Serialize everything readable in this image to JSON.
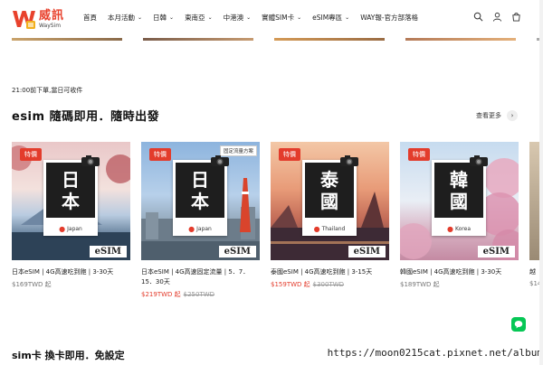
{
  "brand": {
    "name": "威訊",
    "sub": "WaySim",
    "color": "#e8412c"
  },
  "nav": [
    {
      "label": "首頁",
      "dropdown": false
    },
    {
      "label": "本月活動",
      "dropdown": true
    },
    {
      "label": "日韓",
      "dropdown": true
    },
    {
      "label": "東南亞",
      "dropdown": true
    },
    {
      "label": "中港澳",
      "dropdown": true
    },
    {
      "label": "實體SIM卡",
      "dropdown": true
    },
    {
      "label": "eSIM專區",
      "dropdown": true
    },
    {
      "label": "WAY報-官方部落格",
      "dropdown": false
    }
  ],
  "header_icons": [
    "search-icon",
    "user-icon",
    "cart-icon"
  ],
  "notice": "21:00前下單,當日可收件",
  "section": {
    "title": "esim 隨碼即用．隨時出發",
    "view_more": "查看更多"
  },
  "products": [
    {
      "tag": "特價",
      "frame_text": [
        "日",
        "本"
      ],
      "location": "Japan",
      "badge": "eSIM",
      "plan_label": "",
      "title": "日本eSIM | 4G高速吃到飽 | 3-30天",
      "price": "$169TWD 起",
      "sale": "",
      "original": ""
    },
    {
      "tag": "特價",
      "frame_text": [
        "日",
        "本"
      ],
      "location": "Japan",
      "badge": "eSIM",
      "plan_label": "固定流量方案",
      "title": "日本eSIM | 4G高速固定流量 | 5．7．15．30天",
      "price": "",
      "sale": "$219TWD 起",
      "original": "$250TWD"
    },
    {
      "tag": "特價",
      "frame_text": [
        "泰",
        "國"
      ],
      "location": "Thailand",
      "badge": "eSIM",
      "plan_label": "",
      "title": "泰國eSIM | 4G高速吃到飽 | 3-15天",
      "price": "",
      "sale": "$159TWD 起",
      "original": "$300TWD"
    },
    {
      "tag": "特價",
      "frame_text": [
        "韓",
        "國"
      ],
      "location": "Korea",
      "badge": "eSIM",
      "plan_label": "",
      "title": "韓國eSIM | 4G高速吃到飽 | 3-30天",
      "price": "$189TWD 起",
      "sale": "",
      "original": ""
    },
    {
      "tag": "",
      "frame_text": [],
      "location": "",
      "badge": "",
      "plan_label": "",
      "title": "越",
      "price": "$14",
      "sale": "",
      "original": ""
    }
  ],
  "bottom": {
    "title": "sim卡 換卡即用．免設定",
    "url": "https://moon0215cat.pixnet.net/album"
  },
  "colors": {
    "accent": "#e33c2c",
    "line": "#06c755"
  }
}
